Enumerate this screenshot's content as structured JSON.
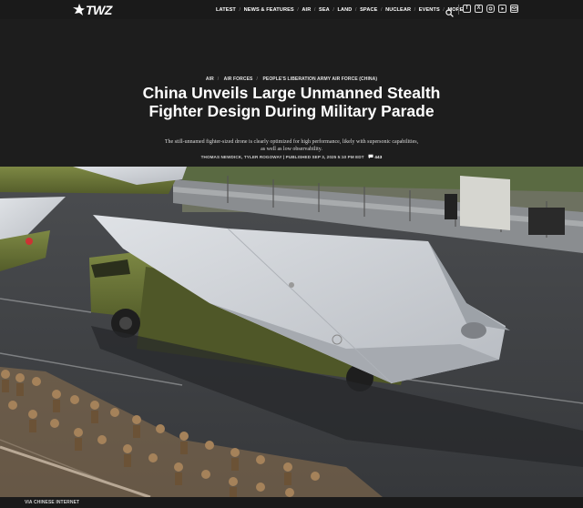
{
  "site": {
    "logo_text": "TWZ"
  },
  "nav": {
    "items": [
      "LATEST",
      "NEWS & FEATURES",
      "AIR",
      "SEA",
      "LAND",
      "SPACE",
      "NUCLEAR",
      "EVENTS",
      "MORE"
    ],
    "social_icons": [
      "facebook-icon",
      "x-icon",
      "instagram-icon",
      "youtube-icon",
      "email-icon"
    ]
  },
  "article": {
    "breadcrumbs": [
      "AIR",
      "AIR FORCES",
      "PEOPLE'S LIBERATION ARMY AIR FORCE (CHINA)"
    ],
    "title": "China Unveils Large Unmanned Stealth Fighter Design During Military Parade",
    "dek": "The still-unnamed fighter-sized drone is clearly optimized for high performance, likely with supersonic capabilities, as well as low observability.",
    "byline": "THOMAS NEWDICK, TYLER ROGOWAY | PUBLISHED SEP 3, 2025 5:10 PM EDT",
    "comment_icon": "comment-icon",
    "comment_count": "443",
    "image_caption": "VIA CHINESE INTERNET"
  },
  "colors": {
    "background": "#1d1d1d",
    "nav": "#1a1a1a",
    "truck": "#6f7a3a",
    "drone": "#c9ccd1"
  }
}
